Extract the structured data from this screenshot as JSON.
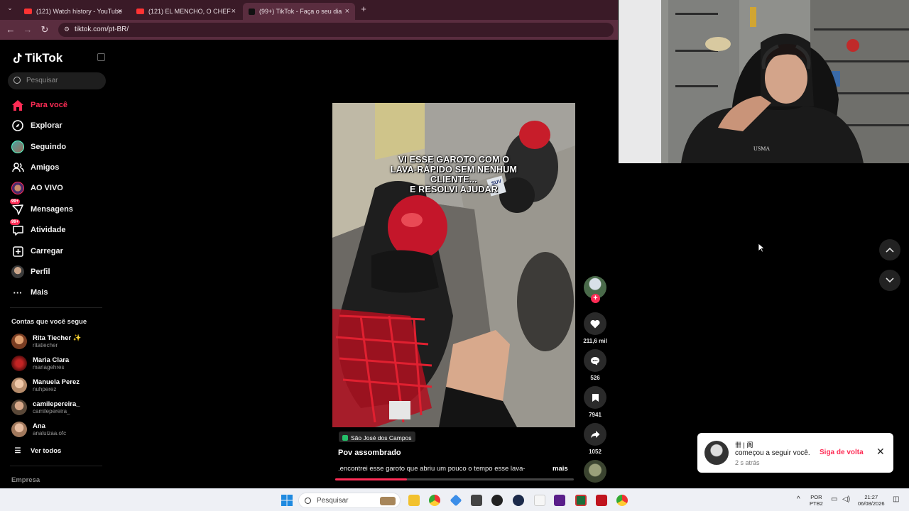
{
  "browser": {
    "tabs": [
      {
        "label": "(121) Watch history - YouTube",
        "icon": "youtube-icon"
      },
      {
        "label": "(121) EL MENCHO, O CHEFE DE",
        "icon": "youtube-icon"
      },
      {
        "label": "(99+) TikTok - Faça o seu dia",
        "icon": "tiktok-icon",
        "active": true
      }
    ],
    "new_tab": "+",
    "url": "tiktok.com/pt-BR/"
  },
  "sidebar": {
    "logo": "TikTok",
    "search_placeholder": "Pesquisar",
    "nav": [
      {
        "label": "Para você",
        "icon": "home-icon",
        "active": true
      },
      {
        "label": "Explorar",
        "icon": "compass-icon"
      },
      {
        "label": "Seguindo",
        "icon": "following-avatar-icon"
      },
      {
        "label": "Amigos",
        "icon": "friends-icon"
      },
      {
        "label": "AO VIVO",
        "icon": "live-icon"
      },
      {
        "label": "Mensagens",
        "icon": "messages-icon",
        "badge": "99+"
      },
      {
        "label": "Atividade",
        "icon": "activity-icon",
        "badge": "99+"
      },
      {
        "label": "Carregar",
        "icon": "upload-icon"
      },
      {
        "label": "Perfil",
        "icon": "profile-icon"
      },
      {
        "label": "Mais",
        "icon": "more-icon"
      }
    ],
    "following_title": "Contas que você segue",
    "following": [
      {
        "name": "Rita Tiecher ✨",
        "handle": "ritatiecher"
      },
      {
        "name": "Maria Clara",
        "handle": "mariagehres"
      },
      {
        "name": "Manuela Perez",
        "handle": "nuhperez"
      },
      {
        "name": "camilepereira_",
        "handle": "camilepereira_"
      },
      {
        "name": "Ana",
        "handle": "analuizaa.ofc"
      }
    ],
    "see_all": "Ver todos",
    "footer": "Empresa"
  },
  "video": {
    "overlay_text": [
      "VI ESSE GAROTO COM O",
      "LAVA-RÁPIDO SEM NENHUM",
      "CLIENTE...",
      "E RESOLVI AJUDAR"
    ],
    "plate_text": "SUV",
    "location": "São José dos Campos",
    "title": "Pov assombrado",
    "description": ".encontrei esse garoto que abriu um pouco o tempo esse lava-",
    "more": "mais",
    "progress": 0.3
  },
  "actions": {
    "likes": "211,6 mil",
    "comments": "526",
    "saves": "7941",
    "shares": "1052"
  },
  "notification": {
    "user": "卌 | 阁",
    "message": "começou a seguir você.",
    "time": "2 s atrás",
    "follow_back": "Siga de volta"
  },
  "taskbar": {
    "search": "Pesquisar",
    "lang": "POR",
    "layout": "PTB2",
    "time": "21:27",
    "date": "06/08/2026"
  },
  "colors": {
    "accent": "#fe2c55",
    "tab_bar": "#3a1a27",
    "chrome": "#5a2d3f"
  }
}
